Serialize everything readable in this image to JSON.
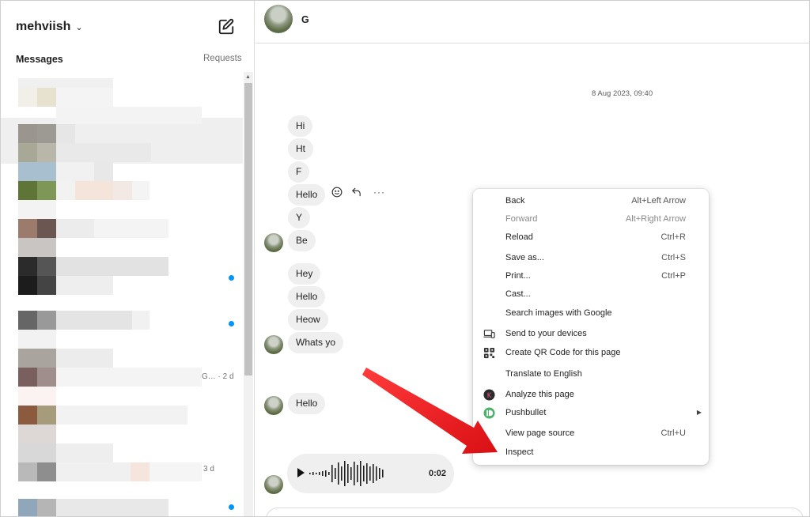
{
  "account": {
    "username": "mehviish"
  },
  "left": {
    "messages_heading": "Messages",
    "requests_label": "Requests",
    "row_meta": [
      "G… · 2 d",
      "3 d"
    ]
  },
  "chat": {
    "contact_name": "G",
    "date_divider": "8 Aug 2023, 09:40",
    "group1": [
      "Hi",
      "Ht",
      "F",
      "Hello",
      "Y",
      "Be"
    ],
    "group2": [
      "Hey",
      "Hello",
      "Heow",
      "Whats yo"
    ],
    "group3": [
      "Hello"
    ],
    "voice_duration": "0:02"
  },
  "context_menu": {
    "items": [
      {
        "label": "Back",
        "shortcut": "Alt+Left Arrow"
      },
      {
        "label": "Forward",
        "shortcut": "Alt+Right Arrow"
      },
      {
        "label": "Reload",
        "shortcut": "Ctrl+R"
      },
      {
        "label": "Save as...",
        "shortcut": "Ctrl+S"
      },
      {
        "label": "Print...",
        "shortcut": "Ctrl+P"
      },
      {
        "label": "Cast...",
        "shortcut": ""
      },
      {
        "label": "Search images with Google",
        "shortcut": ""
      },
      {
        "label": "Send to your devices",
        "shortcut": ""
      },
      {
        "label": "Create QR Code for this page",
        "shortcut": ""
      },
      {
        "label": "Translate to English",
        "shortcut": ""
      },
      {
        "label": "Analyze this page",
        "shortcut": ""
      },
      {
        "label": "Pushbullet",
        "shortcut": ""
      },
      {
        "label": "View page source",
        "shortcut": "Ctrl+U"
      },
      {
        "label": "Inspect",
        "shortcut": ""
      }
    ]
  },
  "colors": {
    "unread_dot": "#0095f6",
    "bubble_bg": "#efefef",
    "annotation_arrow": "#e8141a"
  },
  "icons": [
    "chevron-down-icon",
    "compose-icon",
    "emoji-icon",
    "reply-icon",
    "more-icon",
    "play-icon",
    "devices-icon",
    "qr-code-icon",
    "analyze-icon",
    "pushbullet-icon",
    "submenu-arrow-icon"
  ]
}
